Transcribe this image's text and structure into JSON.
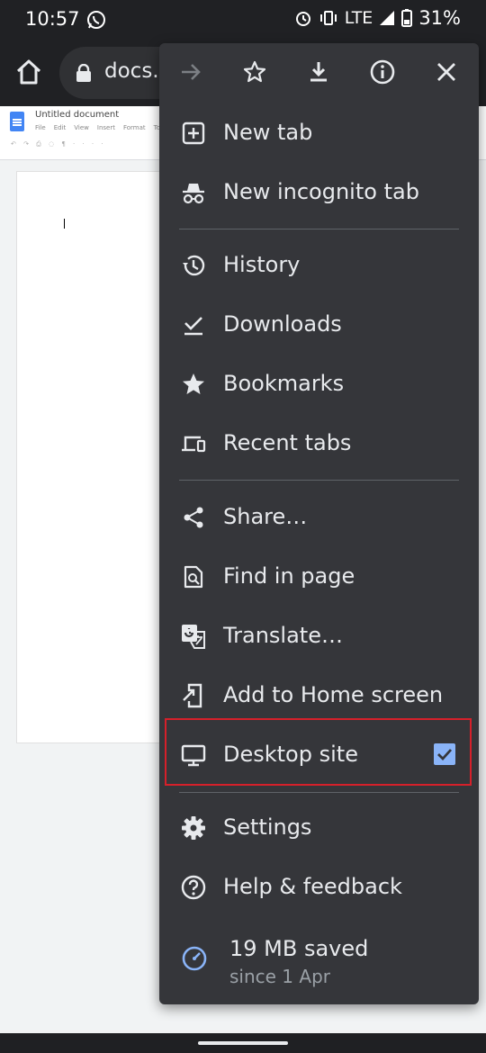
{
  "status_bar": {
    "time": "10:57",
    "network": "LTE",
    "battery": "31%"
  },
  "toolbar": {
    "url_text": "docs."
  },
  "document": {
    "title": "Untitled document",
    "menu_items": [
      "File",
      "Edit",
      "View",
      "Insert",
      "Format",
      "To"
    ]
  },
  "menu": {
    "top_actions": [
      "forward-icon",
      "bookmark-star-icon",
      "download-icon",
      "info-icon",
      "close-icon"
    ],
    "items": {
      "new_tab": "New tab",
      "new_incognito_tab": "New incognito tab",
      "history": "History",
      "downloads": "Downloads",
      "bookmarks": "Bookmarks",
      "recent_tabs": "Recent tabs",
      "share": "Share…",
      "find_in_page": "Find in page",
      "translate": "Translate…",
      "add_to_home_screen": "Add to Home screen",
      "desktop_site": "Desktop site",
      "settings": "Settings",
      "help_feedback": "Help & feedback"
    },
    "desktop_site_checked": true,
    "data_saver": {
      "main": "19 MB saved",
      "sub": "since 1 Apr"
    }
  },
  "colors": {
    "menu_bg": "#35363a",
    "accent": "#8ab4f8",
    "highlight": "#d6202a"
  }
}
